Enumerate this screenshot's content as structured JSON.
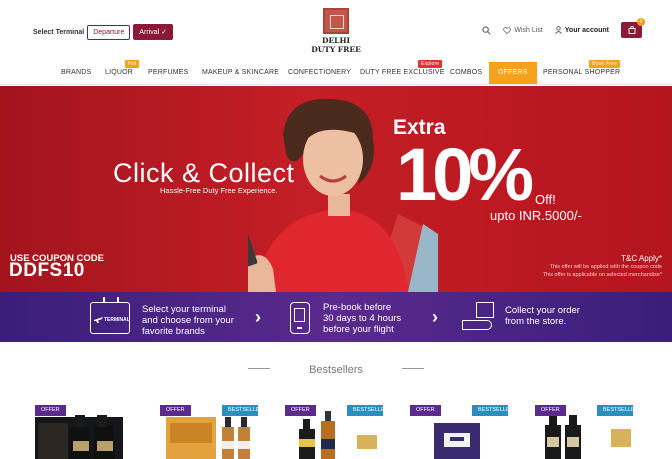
{
  "header": {
    "select_terminal_label": "Select Terminal",
    "departure_label": "Departure",
    "arrival_label": "Arrival ✓",
    "logo_line1": "DELHI",
    "logo_line2": "DUTY FREE",
    "wishlist_label": "Wish List",
    "account_label": "Your account",
    "cart_count": "0"
  },
  "nav": {
    "items": [
      "BRANDS",
      "LIQUOR",
      "PERFUMES",
      "MAKEUP & SKINCARE",
      "CONFECTIONERY",
      "DUTY FREE EXCLUSIVE",
      "COMBOS",
      "OFFERS",
      "PERSONAL SHOPPER"
    ],
    "tags": {
      "liquor": "Hot",
      "exclusive": "Explore",
      "shopper": "Book Free"
    },
    "colors": {
      "hot": "#f4a21c",
      "explore": "#e0342b",
      "book_free": "#f4a21c",
      "offers_bg": "#f4a21c"
    }
  },
  "hero": {
    "title": "Click & Collect",
    "subtitle": "Hassle-Free Duty Free Experience.",
    "extra": "Extra",
    "percent": "10%",
    "off": "Off!",
    "upto": "upto INR.5000/-",
    "coupon_label": "USE COUPON CODE",
    "coupon_code": "DDFS10",
    "tc": "T&C Apply*",
    "note1": "This offer will be applied with the coupon code",
    "note2": "This offer is applicable on selected merchandise*"
  },
  "steps": [
    {
      "icon": "terminal-sign-icon",
      "icon_text": "TERMINAL",
      "line1": "Select your terminal",
      "line2": "and choose from your",
      "line3": "favorite brands"
    },
    {
      "icon": "mobile-booking-icon",
      "line1": "Pre-book before",
      "line2": "30 days to 4 hours",
      "line3": "before your flight"
    },
    {
      "icon": "store-pickup-icon",
      "line1": "Collect your order",
      "line2": "from the store."
    }
  ],
  "bestsellers": {
    "title": "Bestsellers",
    "offer_badge": "OFFER",
    "bestseller_badge": "BESTSELLER"
  }
}
